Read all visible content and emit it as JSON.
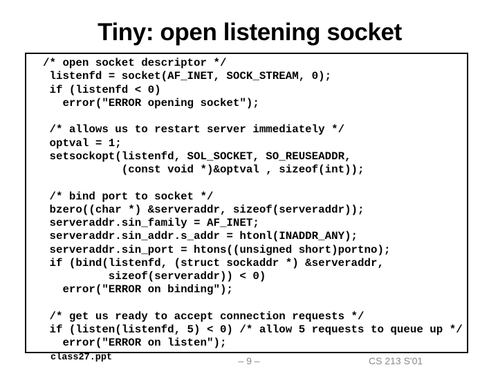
{
  "slide": {
    "title": "Tiny: open listening socket"
  },
  "code": {
    "lines": [
      "/* open socket descriptor */",
      " listenfd = socket(AF_INET, SOCK_STREAM, 0);",
      " if (listenfd < 0)",
      "   error(\"ERROR opening socket\");",
      "",
      " /* allows us to restart server immediately */",
      " optval = 1;",
      " setsockopt(listenfd, SOL_SOCKET, SO_REUSEADDR,",
      "            (const void *)&optval , sizeof(int));",
      "",
      " /* bind port to socket */",
      " bzero((char *) &serveraddr, sizeof(serveraddr));",
      " serveraddr.sin_family = AF_INET;",
      " serveraddr.sin_addr.s_addr = htonl(INADDR_ANY);",
      " serveraddr.sin_port = htons((unsigned short)portno);",
      " if (bind(listenfd, (struct sockaddr *) &serveraddr,",
      "          sizeof(serveraddr)) < 0)",
      "   error(\"ERROR on binding\");",
      "",
      " /* get us ready to accept connection requests */",
      " if (listen(listenfd, 5) < 0) /* allow 5 requests to queue up */",
      "   error(\"ERROR on listen\");"
    ]
  },
  "footer": {
    "file": "class27.ppt",
    "page": "– 9 –",
    "course": "CS 213 S'01"
  }
}
